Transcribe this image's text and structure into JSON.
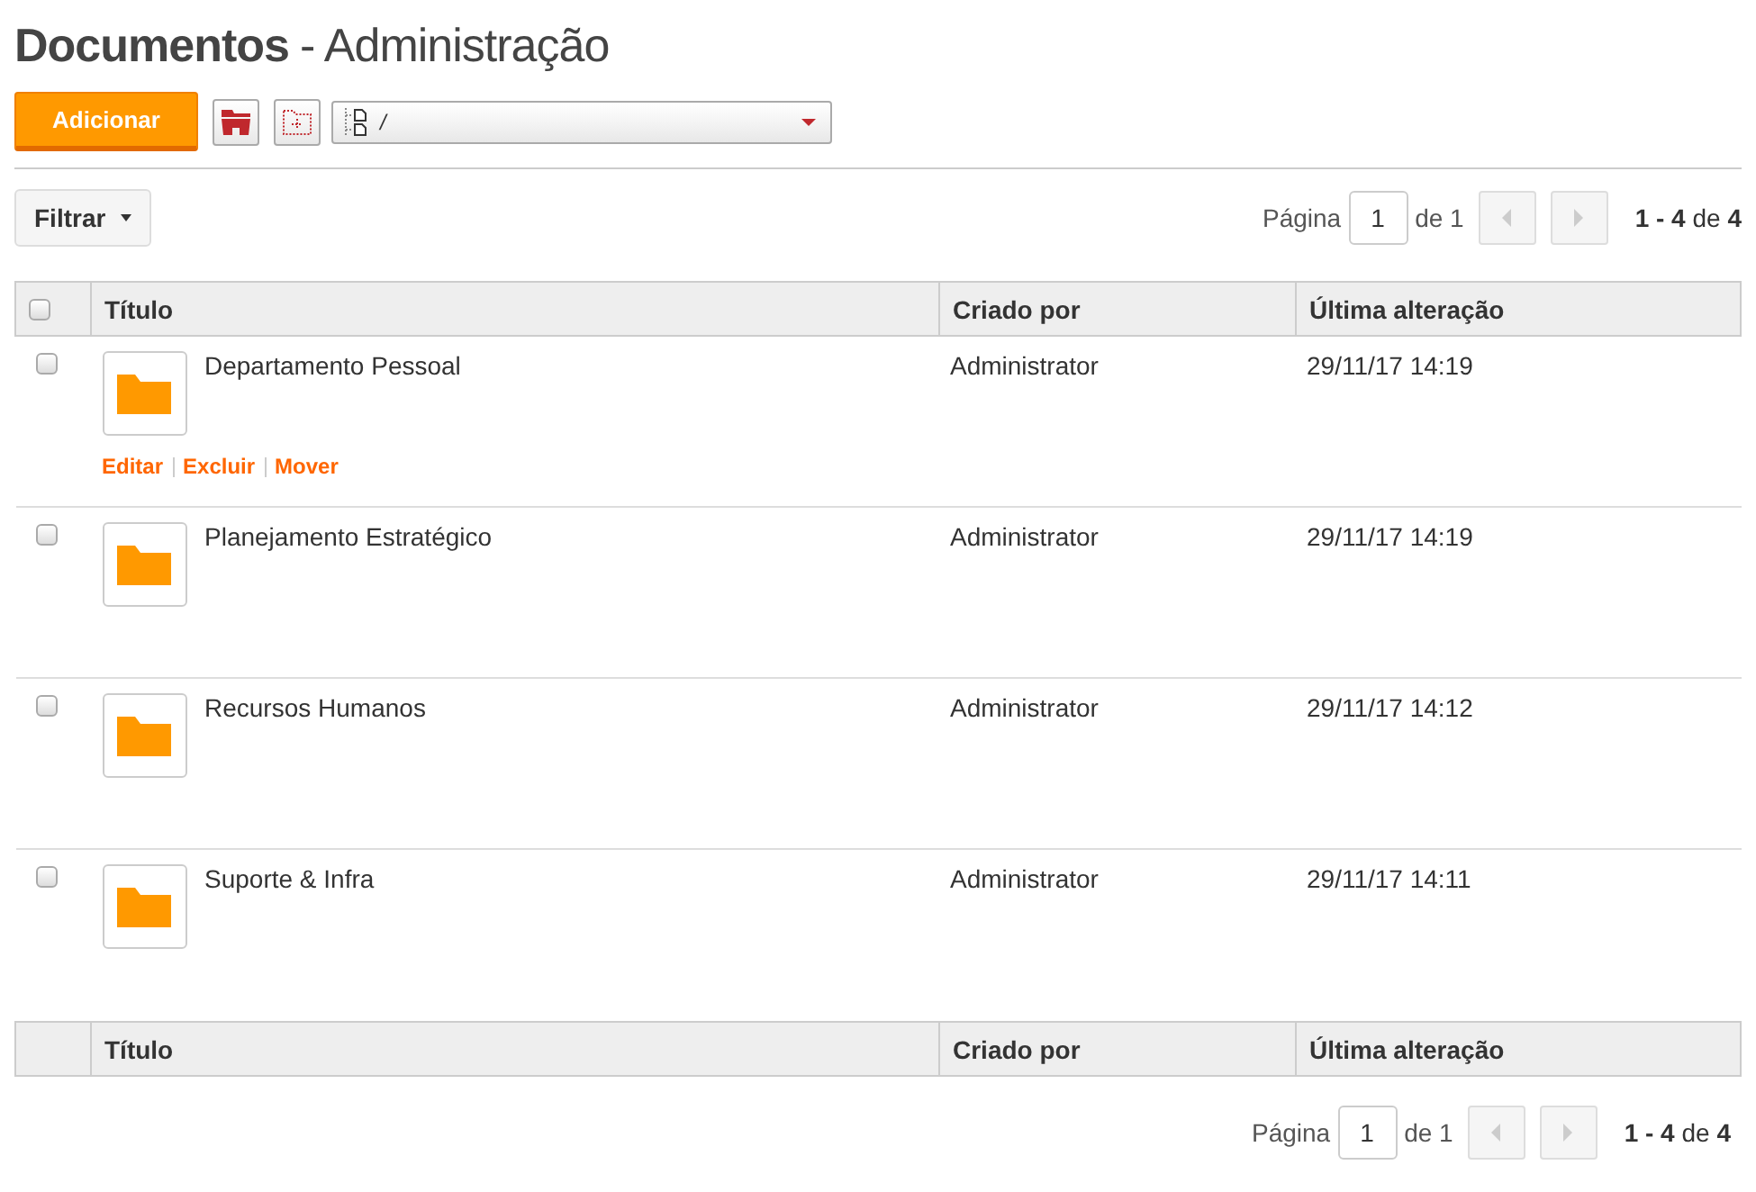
{
  "title": {
    "main": "Documentos",
    "sub": "- Administração"
  },
  "toolbar": {
    "add_button": "Adicionar",
    "path": "/"
  },
  "filter_button": "Filtrar",
  "pagination_top": {
    "label": "Página",
    "page": "1",
    "of": "de 1",
    "summary": "**1 - 4** de **4**"
  },
  "table": {
    "columns": [
      "Título",
      "Criado por",
      "Última alteração"
    ],
    "select_all_checked": false,
    "rows": [
      {
        "title": "Departamento Pessoal",
        "created_by": "Administrator",
        "modified": "29/11/17 14:19",
        "checked": false,
        "actions": [
          "Editar",
          "Excluir",
          "Mover"
        ]
      },
      {
        "title": "Planejamento Estratégico",
        "created_by": "Administrator",
        "modified": "29/11/17 14:19",
        "checked": false
      },
      {
        "title": "Recursos Humanos",
        "created_by": "Administrator",
        "modified": "29/11/17 14:12",
        "checked": false
      },
      {
        "title": "Suporte & Infra",
        "created_by": "Administrator",
        "modified": "29/11/17 14:11",
        "checked": false
      }
    ],
    "footer_columns": [
      "Título",
      "Criado por",
      "Última alteração"
    ]
  },
  "pagination_bottom": {
    "label": "Página",
    "page": "1",
    "of": "de 1",
    "summary": "**1 - 4** de **4**"
  }
}
